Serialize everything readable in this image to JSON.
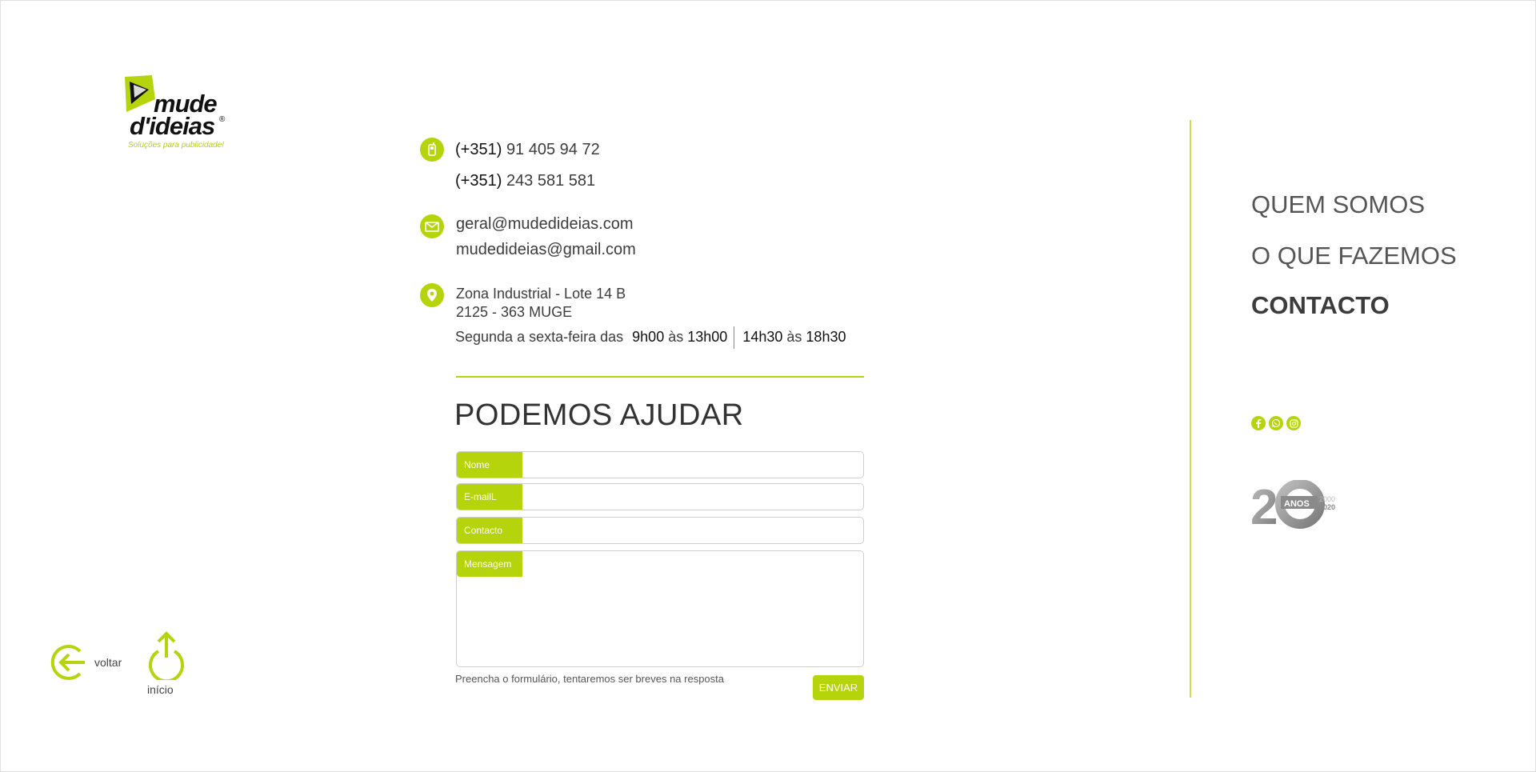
{
  "brand": {
    "name_line1": "mude",
    "name_line2": "d'ideias",
    "registered": "®",
    "tagline": "Soluções para publicidade!",
    "accent_color": "#b6d40b"
  },
  "contact": {
    "phone_icon": "phone-icon",
    "phones": [
      {
        "prefix": "(+351)",
        "number": "91 405 94 72"
      },
      {
        "prefix": "(+351)",
        "number": "243 581 581"
      }
    ],
    "mail_icon": "mail-icon",
    "emails": [
      "geral@mudedideias.com",
      "mudedideias@gmail.com"
    ],
    "location_icon": "location-pin-icon",
    "address_line1": "Zona Industrial - Lote 14 B",
    "address_line2": "2125 - 363 MUGE",
    "hours": {
      "days": "Segunda a sexta-feira das",
      "morning_start": "9h00",
      "morning_sep": "às",
      "morning_end": "13h00",
      "afternoon_start": "14h30",
      "afternoon_sep": "às",
      "afternoon_end": "18h30"
    }
  },
  "form": {
    "title": "PODEMOS AJUDAR",
    "fields": [
      {
        "label": "Nome",
        "value": ""
      },
      {
        "label": "E-mailL",
        "value": ""
      },
      {
        "label": "Contacto",
        "value": ""
      },
      {
        "label": "Mensagem",
        "value": ""
      }
    ],
    "note": "Preencha o formulário, tentaremos ser breves na resposta",
    "submit_label": "ENVIAR"
  },
  "nav": {
    "items": [
      {
        "label": "QUEM SOMOS",
        "active": false
      },
      {
        "label": "O QUE FAZEMOS",
        "active": false
      },
      {
        "label": "CONTACTO",
        "active": true
      }
    ],
    "social_icons": [
      "facebook-icon",
      "whatsapp-icon",
      "instagram-icon"
    ]
  },
  "badge": {
    "number_left": "2",
    "number_right": "0",
    "label": "ANOS",
    "year_start": "2000",
    "year_end": "2020"
  },
  "footer_nav": {
    "back_label": "voltar",
    "home_label": "início"
  }
}
